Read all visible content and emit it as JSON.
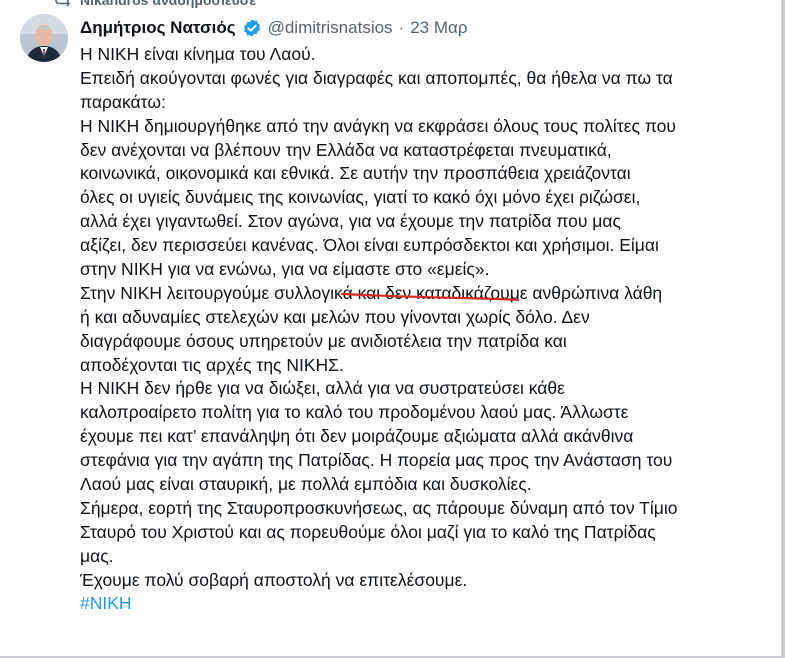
{
  "repost": {
    "text": "Nikandros αναδημοσίευσε"
  },
  "author": {
    "display_name": "Δημήτριος Νατσιός",
    "handle": "@dimitrisnatsios",
    "separator": "·",
    "date": "23 Μαρ"
  },
  "tweet_lines": [
    "Η ΝΙΚΗ είναι κίνημα του Λαού.",
    "Επειδή ακούγονται φωνές για διαγραφές και αποπομπές, θα ήθελα να πω τα",
    "παρακάτω:",
    "Η ΝΙΚΗ δημιουργήθηκε από την ανάγκη να εκφράσει όλους τους πολίτες που",
    "δεν ανέχονται να βλέπουν την Ελλάδα να καταστρέφεται πνευματικά,",
    "κοινωνικά, οικονομικά και εθνικά. Σε αυτήν την προσπάθεια χρειάζονται",
    "όλες οι υγιείς δυνάμεις της κοινωνίας, γιατί το κακό όχι μόνο έχει ριζώσει,",
    "αλλά έχει γιγαντωθεί. Στον αγώνα, για να έχουμε την πατρίδα που μας",
    "αξίζει, δεν περισσεύει κανένας. Όλοι είναι ευπρόσδεκτοι και χρήσιμοι. Είμαι",
    "στην ΝΙΚΗ για να ενώνω, για να είμαστε στο «εμείς».",
    "Στην ΝΙΚΗ λειτουργούμε συλλογικά και δεν καταδικάζουμε ανθρώπινα λάθη",
    "ή και αδυναμίες στελεχών και μελών που γίνονται χωρίς δόλο. Δεν",
    "διαγράφουμε όσους υπηρετούν με ανιδιοτέλεια την πατρίδα και",
    "αποδέχονται τις αρχές της ΝΙΚΗΣ.",
    "Η ΝΙΚΗ δεν ήρθε για να διώξει, αλλά για να συστρατεύσει κάθε",
    "καλοπροαίρετο πολίτη για το καλό του προδομένου λαού μας. Άλλωστε",
    "έχουμε πει κατ’ επανάληψη ότι δεν μοιράζουμε αξιώματα αλλά ακάνθινα",
    "στεφάνια για την αγάπη της Πατρίδας. Η πορεία μας προς την Ανάσταση του",
    "Λαού μας είναι σταυρική, με πολλά εμπόδια και δυσκολίες.",
    "Σήμερα, εορτή της Σταυροπροσκυνήσεως, ας πάρουμε δύναμη από τον Τίμιο",
    "Σταυρό του Χριστού και ας πορευθούμε όλοι μαζί για το καλό της Πατρίδας",
    "μας.",
    "Έχουμε πολύ σοβαρή αποστολή να επιτελέσουμε."
  ],
  "hashtag": "#ΝΙΚΗ",
  "icons": {
    "repost": "repost-icon",
    "verified": "verified-badge-icon",
    "avatar": "profile-photo"
  },
  "colors": {
    "text": "#0f1419",
    "secondary": "#536471",
    "link": "#1d9bf0",
    "verified": "#1d9bf0",
    "annotation": "#d62b1f"
  }
}
